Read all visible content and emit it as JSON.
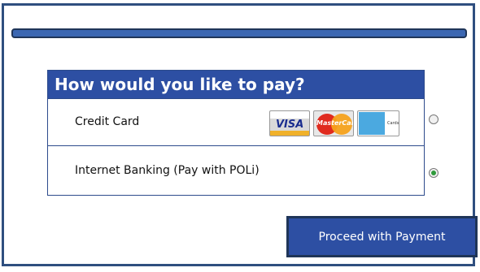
{
  "payment": {
    "heading": "How would you like to pay?",
    "options": [
      {
        "label": "Credit Card",
        "selected": false
      },
      {
        "label": "Internet Banking (Pay with POLi)",
        "selected": true
      }
    ],
    "card_logos": {
      "visa": "VISA",
      "mastercard": "MasterCard",
      "amex_cards": "Cards"
    }
  },
  "actions": {
    "proceed_label": "Proceed with Payment"
  },
  "colors": {
    "primary": "#2d4fa3",
    "border": "#1f3558",
    "selected_radio": "#2f9a3b"
  }
}
